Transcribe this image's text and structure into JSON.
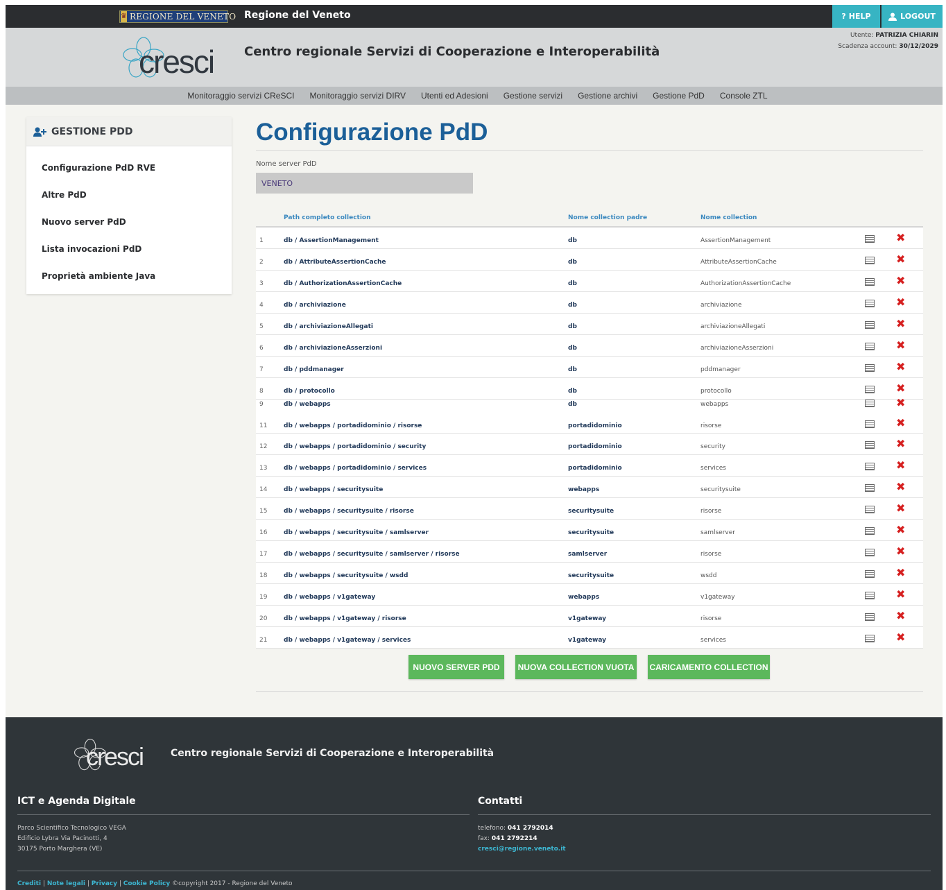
{
  "topbar": {
    "region_logo": "REGIONE DEL VENETO",
    "region_title": "Regione del Veneto",
    "help_label": "HELP",
    "logout_label": "LOGOUT"
  },
  "header": {
    "logo_text": "cresci",
    "title": "Centro regionale Servizi di Cooperazione e Interoperabilità",
    "user_label": "Utente:",
    "user_name": "PATRIZIA CHIARIN",
    "expiry_label": "Scadenza account:",
    "expiry_value": "30/12/2029"
  },
  "nav": {
    "items": [
      "Monitoraggio servizi CReSCI",
      "Monitoraggio servizi DIRV",
      "Utenti ed Adesioni",
      "Gestione servizi",
      "Gestione archivi",
      "Gestione PdD",
      "Console ZTL"
    ]
  },
  "sidebar": {
    "title": "GESTIONE PDD",
    "items": [
      "Configurazione PdD RVE",
      "Altre PdD",
      "Nuovo server PdD",
      "Lista invocazioni PdD",
      "Proprietà ambiente Java"
    ]
  },
  "main": {
    "title": "Configurazione PdD",
    "server_label": "Nome server PdD",
    "server_value": "VENETO",
    "table": {
      "headers": [
        "Path completo collection",
        "Nome collection padre",
        "Nome collection"
      ],
      "rows": [
        {
          "n": "1",
          "path": "db / AssertionManagement",
          "parent": "db",
          "name": "AssertionManagement"
        },
        {
          "n": "2",
          "path": "db / AttributeAssertionCache",
          "parent": "db",
          "name": "AttributeAssertionCache"
        },
        {
          "n": "3",
          "path": "db / AuthorizationAssertionCache",
          "parent": "db",
          "name": "AuthorizationAssertionCache"
        },
        {
          "n": "4",
          "path": "db / archiviazione",
          "parent": "db",
          "name": "archiviazione"
        },
        {
          "n": "5",
          "path": "db / archiviazioneAllegati",
          "parent": "db",
          "name": "archiviazioneAllegati"
        },
        {
          "n": "6",
          "path": "db / archiviazioneAsserzioni",
          "parent": "db",
          "name": "archiviazioneAsserzioni"
        },
        {
          "n": "7",
          "path": "db / pddmanager",
          "parent": "db",
          "name": "pddmanager"
        },
        {
          "n": "8",
          "path": "db / protocollo",
          "parent": "db",
          "name": "protocollo"
        },
        {
          "n": "9",
          "path": "db / webapps",
          "parent": "db",
          "name": "webapps"
        },
        {
          "n": "11",
          "path": "db / webapps / portadidominio / risorse",
          "parent": "portadidominio",
          "name": "risorse"
        },
        {
          "n": "12",
          "path": "db / webapps / portadidominio / security",
          "parent": "portadidominio",
          "name": "security"
        },
        {
          "n": "13",
          "path": "db / webapps / portadidominio / services",
          "parent": "portadidominio",
          "name": "services"
        },
        {
          "n": "14",
          "path": "db / webapps / securitysuite",
          "parent": "webapps",
          "name": "securitysuite"
        },
        {
          "n": "15",
          "path": "db / webapps / securitysuite / risorse",
          "parent": "securitysuite",
          "name": "risorse"
        },
        {
          "n": "16",
          "path": "db / webapps / securitysuite / samlserver",
          "parent": "securitysuite",
          "name": "samlserver"
        },
        {
          "n": "17",
          "path": "db / webapps / securitysuite / samlserver / risorse",
          "parent": "samlserver",
          "name": "risorse"
        },
        {
          "n": "18",
          "path": "db / webapps / securitysuite / wsdd",
          "parent": "securitysuite",
          "name": "wsdd"
        },
        {
          "n": "19",
          "path": "db / webapps / v1gateway",
          "parent": "webapps",
          "name": "v1gateway"
        },
        {
          "n": "20",
          "path": "db / webapps / v1gateway / risorse",
          "parent": "v1gateway",
          "name": "risorse"
        },
        {
          "n": "21",
          "path": "db / webapps / v1gateway / services",
          "parent": "v1gateway",
          "name": "services"
        }
      ]
    },
    "buttons": {
      "new_server": "NUOVO SERVER PDD",
      "new_collection": "NUOVA COLLECTION VUOTA",
      "load_collection": "CARICAMENTO COLLECTION"
    }
  },
  "footer": {
    "logo_text": "cresci",
    "title": "Centro regionale Servizi di Cooperazione e Interoperabilità",
    "left_heading": "ICT e Agenda Digitale",
    "address_lines": [
      "Parco Scientifico Tecnologico VEGA",
      "Edificio Lybra Via Pacinotti, 4",
      "30175 Porto Marghera (VE)"
    ],
    "right_heading": "Contatti",
    "phone_label": "telefono:",
    "phone": "041 2792014",
    "fax_label": "fax:",
    "fax": "041 2792214",
    "email": "cresci@regione.veneto.it",
    "links": [
      "Crediti",
      "Note legali",
      "Privacy",
      "Cookie Policy"
    ],
    "copyright": "©copyright 2017 - Regione del Veneto"
  }
}
